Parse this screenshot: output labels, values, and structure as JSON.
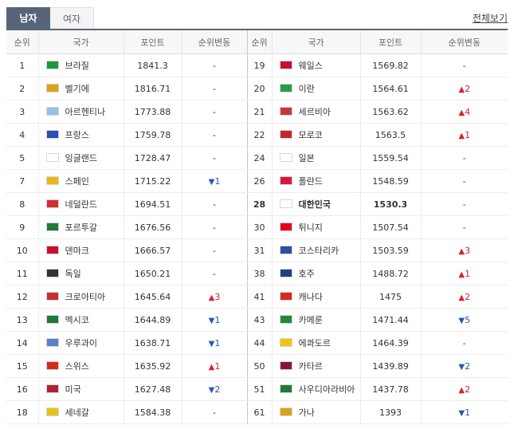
{
  "tabs": {
    "men": "남자",
    "women": "여자"
  },
  "view_all": "전체보기",
  "headers": {
    "rank": "순위",
    "country": "국가",
    "points": "포인트",
    "change": "순위변동"
  },
  "left": [
    {
      "rank": "1",
      "country": "브라질",
      "points": "1841.3",
      "change": "-",
      "dir": "none",
      "flag": "flag-brazil-icon",
      "fc": "#1a9a3a"
    },
    {
      "rank": "2",
      "country": "벨기에",
      "points": "1816.71",
      "change": "-",
      "dir": "none",
      "flag": "flag-belgium-icon",
      "fc": "#d9a21a"
    },
    {
      "rank": "3",
      "country": "아르헨티나",
      "points": "1773.88",
      "change": "-",
      "dir": "none",
      "flag": "flag-argentina-icon",
      "fc": "#8fc3ea"
    },
    {
      "rank": "4",
      "country": "프랑스",
      "points": "1759.78",
      "change": "-",
      "dir": "none",
      "flag": "flag-france-icon",
      "fc": "#2c4db3"
    },
    {
      "rank": "5",
      "country": "잉글랜드",
      "points": "1728.47",
      "change": "-",
      "dir": "none",
      "flag": "flag-england-icon",
      "fc": "#ffffff"
    },
    {
      "rank": "7",
      "country": "스페인",
      "points": "1715.22",
      "change": "1",
      "dir": "down",
      "flag": "flag-spain-icon",
      "fc": "#e8b81c"
    },
    {
      "rank": "8",
      "country": "네덜란드",
      "points": "1694.51",
      "change": "-",
      "dir": "none",
      "flag": "flag-netherlands-icon",
      "fc": "#d23030"
    },
    {
      "rank": "9",
      "country": "포르투갈",
      "points": "1676.56",
      "change": "-",
      "dir": "none",
      "flag": "flag-portugal-icon",
      "fc": "#1f7a3a"
    },
    {
      "rank": "10",
      "country": "덴마크",
      "points": "1666.57",
      "change": "-",
      "dir": "none",
      "flag": "flag-denmark-icon",
      "fc": "#c8102e"
    },
    {
      "rank": "11",
      "country": "독일",
      "points": "1650.21",
      "change": "-",
      "dir": "none",
      "flag": "flag-germany-icon",
      "fc": "#333333"
    },
    {
      "rank": "12",
      "country": "크로아티아",
      "points": "1645.64",
      "change": "3",
      "dir": "up",
      "flag": "flag-croatia-icon",
      "fc": "#c9302c"
    },
    {
      "rank": "13",
      "country": "멕시코",
      "points": "1644.89",
      "change": "1",
      "dir": "down",
      "flag": "flag-mexico-icon",
      "fc": "#1f7a3a"
    },
    {
      "rank": "14",
      "country": "우루과이",
      "points": "1638.71",
      "change": "1",
      "dir": "down",
      "flag": "flag-uruguay-icon",
      "fc": "#5a7fc4"
    },
    {
      "rank": "15",
      "country": "스위스",
      "points": "1635.92",
      "change": "1",
      "dir": "up",
      "flag": "flag-switzerland-icon",
      "fc": "#d52b1e"
    },
    {
      "rank": "16",
      "country": "미국",
      "points": "1627.48",
      "change": "2",
      "dir": "down",
      "flag": "flag-usa-icon",
      "fc": "#b22234"
    },
    {
      "rank": "18",
      "country": "세네갈",
      "points": "1584.38",
      "change": "-",
      "dir": "none",
      "flag": "flag-senegal-icon",
      "fc": "#e6c21a"
    }
  ],
  "right": [
    {
      "rank": "19",
      "country": "웨일스",
      "points": "1569.82",
      "change": "-",
      "dir": "none",
      "flag": "flag-wales-icon",
      "fc": "#c8102e"
    },
    {
      "rank": "20",
      "country": "이란",
      "points": "1564.61",
      "change": "2",
      "dir": "up",
      "flag": "flag-iran-icon",
      "fc": "#2a9a4a"
    },
    {
      "rank": "21",
      "country": "세르비아",
      "points": "1563.62",
      "change": "4",
      "dir": "up",
      "flag": "flag-serbia-icon",
      "fc": "#c6363c"
    },
    {
      "rank": "22",
      "country": "모로코",
      "points": "1563.5",
      "change": "1",
      "dir": "up",
      "flag": "flag-morocco-icon",
      "fc": "#c1272d"
    },
    {
      "rank": "24",
      "country": "일본",
      "points": "1559.54",
      "change": "-",
      "dir": "none",
      "flag": "flag-japan-icon",
      "fc": "#ffffff"
    },
    {
      "rank": "26",
      "country": "폴란드",
      "points": "1548.59",
      "change": "-",
      "dir": "none",
      "flag": "flag-poland-icon",
      "fc": "#dc143c"
    },
    {
      "rank": "28",
      "country": "대한민국",
      "points": "1530.3",
      "change": "-",
      "dir": "none",
      "flag": "flag-korea-icon",
      "fc": "#ffffff",
      "highlight": true
    },
    {
      "rank": "30",
      "country": "튀니지",
      "points": "1507.54",
      "change": "-",
      "dir": "none",
      "flag": "flag-tunisia-icon",
      "fc": "#e70013"
    },
    {
      "rank": "31",
      "country": "코스타리카",
      "points": "1503.59",
      "change": "3",
      "dir": "up",
      "flag": "flag-costa-rica-icon",
      "fc": "#2b4ea8"
    },
    {
      "rank": "38",
      "country": "호주",
      "points": "1488.72",
      "change": "1",
      "dir": "up",
      "flag": "flag-australia-icon",
      "fc": "#1f3f8c"
    },
    {
      "rank": "41",
      "country": "캐나다",
      "points": "1475",
      "change": "2",
      "dir": "up",
      "flag": "flag-canada-icon",
      "fc": "#d52b1e"
    },
    {
      "rank": "43",
      "country": "카메룬",
      "points": "1471.44",
      "change": "5",
      "dir": "down",
      "flag": "flag-cameroon-icon",
      "fc": "#1f8a3a"
    },
    {
      "rank": "44",
      "country": "에콰도르",
      "points": "1464.39",
      "change": "-",
      "dir": "none",
      "flag": "flag-ecuador-icon",
      "fc": "#f1c40f"
    },
    {
      "rank": "50",
      "country": "카타르",
      "points": "1439.89",
      "change": "2",
      "dir": "down",
      "flag": "flag-qatar-icon",
      "fc": "#8a1538"
    },
    {
      "rank": "51",
      "country": "사우디아라비아",
      "points": "1437.78",
      "change": "2",
      "dir": "up",
      "flag": "flag-saudi-arabia-icon",
      "fc": "#1f7a3a"
    },
    {
      "rank": "61",
      "country": "가나",
      "points": "1393",
      "change": "1",
      "dir": "down",
      "flag": "flag-ghana-icon",
      "fc": "#d9a21a"
    }
  ]
}
